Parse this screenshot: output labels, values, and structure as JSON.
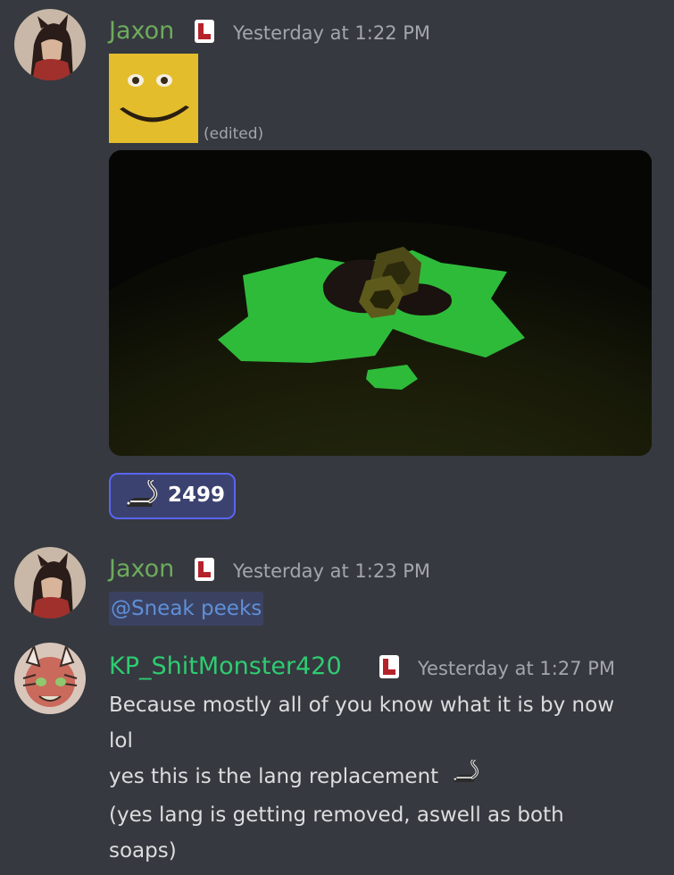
{
  "messages": [
    {
      "username": "Jaxon",
      "name_color": "#6dab5c",
      "timestamp": "Yesterday at 1:22 PM",
      "emoji_name": "smiling-sponge-emoji",
      "edited_label": "(edited)",
      "attachment": "image-attachment",
      "reaction": {
        "icon": "skunk-icon",
        "count": "2499"
      }
    },
    {
      "username": "Jaxon",
      "name_color": "#6dab5c",
      "timestamp": "Yesterday at 1:23 PM",
      "mention": "@Sneak peeks"
    },
    {
      "username": "KP_ShitMonster420",
      "name_color": "#2ecc71",
      "timestamp": "Yesterday at 1:27 PM",
      "lines": [
        "Because mostly all of you know what it is by now",
        "lol",
        "yes this is the lang replacement",
        "(yes lang is getting removed, aswell as both",
        "soaps)"
      ]
    }
  ],
  "colors": {
    "background": "#36393f",
    "mention_text": "#5f8fd8",
    "reaction_border": "#5865f2"
  }
}
